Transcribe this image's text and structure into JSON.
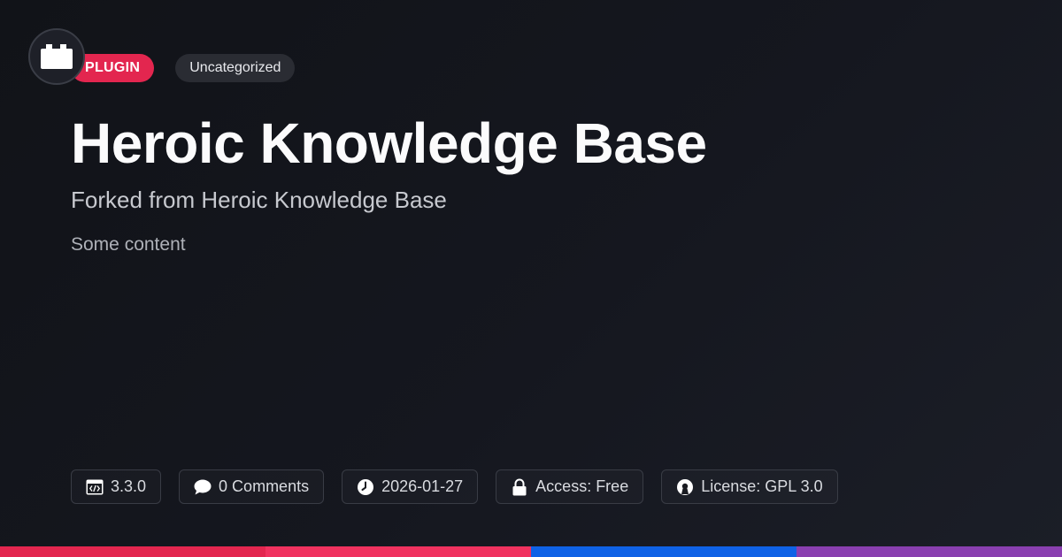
{
  "logo": {
    "icon": "plugin-block-icon"
  },
  "tags": {
    "type": "PLUGIN",
    "category": "Uncategorized"
  },
  "title": "Heroic Knowledge Base",
  "subtitle": "Forked from Heroic Knowledge Base",
  "content": "Some content",
  "meta": {
    "version": {
      "icon": "code-window-icon",
      "text": "3.3.0"
    },
    "comments": {
      "icon": "chat-bubble-icon",
      "text": "0 Comments"
    },
    "date": {
      "icon": "clock-icon",
      "text": "2026-01-27"
    },
    "access": {
      "icon": "lock-icon",
      "text": "Access: Free"
    },
    "license": {
      "icon": "open-source-icon",
      "text": "License: GPL 3.0"
    }
  },
  "colors": {
    "accent": "#e3264f",
    "bar": [
      "#e3264f",
      "#f0325f",
      "#0f62e6",
      "#8a3fb0"
    ]
  }
}
